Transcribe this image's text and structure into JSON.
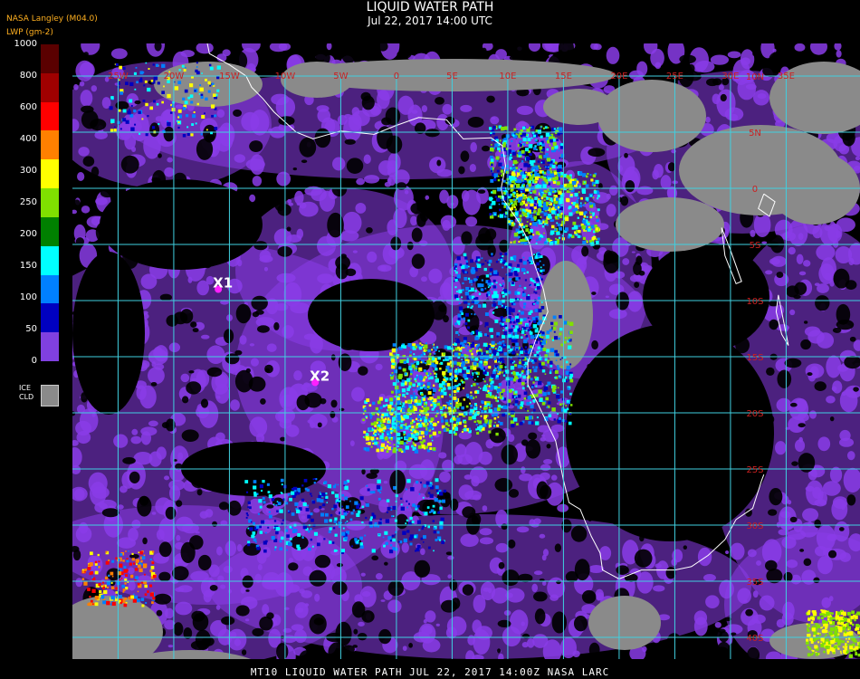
{
  "header": {
    "title": "LIQUID WATER PATH",
    "subtitle": "Jul 22, 2017 14:00 UTC",
    "producer": "NASA Langley (M04.0)",
    "unit_label": "LWP (gm-2)"
  },
  "colorbar": {
    "ticks": [
      "1000",
      "800",
      "600",
      "400",
      "300",
      "250",
      "200",
      "150",
      "100",
      "50",
      "0"
    ],
    "colors": [
      "#5a0000",
      "#a00000",
      "#ff0000",
      "#ff8000",
      "#ffff00",
      "#80e000",
      "#008000",
      "#00ffff",
      "#0080ff",
      "#0000c0",
      "#8040e0"
    ],
    "ice_label_1": "ICE",
    "ice_label_2": "CLD",
    "ice_color": "#8a8a8a"
  },
  "map": {
    "lon_labels": [
      "25W",
      "20W",
      "15W",
      "10W",
      "5W",
      "0",
      "5E",
      "10E",
      "15E",
      "20E",
      "25E",
      "30E",
      "35E"
    ],
    "lat_labels": [
      "10N",
      "5N",
      "0",
      "5S",
      "10S",
      "15S",
      "20S",
      "25S",
      "30S",
      "35S",
      "40S"
    ],
    "grid_color": "#40d0e0",
    "label_color": "#cc2020",
    "markers": [
      {
        "label": "X1",
        "lon": -16.0,
        "lat": -9.0
      },
      {
        "label": "X2",
        "lon": -7.3,
        "lat": -17.3
      }
    ],
    "colors": {
      "clear": "#000000",
      "low": "#8a3ce8",
      "ice": "#8a8a8a",
      "coast": "#ffffff"
    }
  },
  "footer": {
    "text": "MT10  LIQUID WATER PATH   JUL 22, 2017 14:00Z   NASA LARC"
  }
}
